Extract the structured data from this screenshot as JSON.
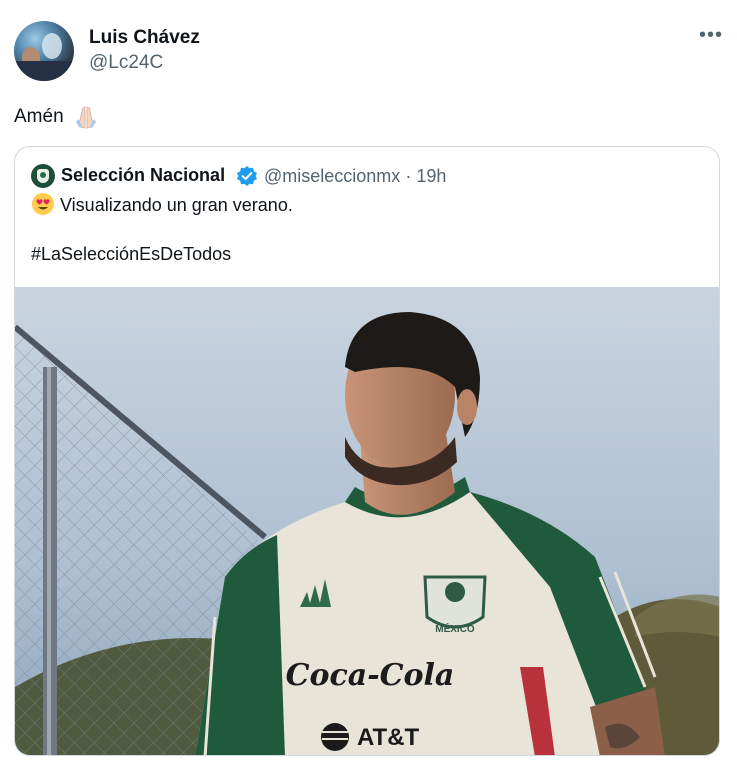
{
  "tweet": {
    "author": {
      "display_name": "Luis Chávez",
      "handle": "@Lc24C"
    },
    "text": "Amén",
    "emoji": "folded-hands",
    "more_label": "•••"
  },
  "quote": {
    "author": {
      "display_name": "Selección Nacional",
      "handle": "@miseleccionmx",
      "time": "· 19h"
    },
    "line1_emoji": "heart-eyes",
    "line1": "Visualizando un gran verano.",
    "hashtag": "#LaSelecciónEsDeTodos",
    "image": {
      "description": "Player in Mexico training jersey in front of a chain-link fence",
      "jersey_crest_text": "MÉXICO",
      "sponsor_1": "Coca-Cola",
      "sponsor_2": "AT&T"
    }
  },
  "colors": {
    "accent_verified": "#1d9bf0",
    "secondary_text": "#536471",
    "border": "#cfd9de",
    "jersey_green": "#1f5a3c",
    "jersey_body": "#e8e4d8"
  }
}
